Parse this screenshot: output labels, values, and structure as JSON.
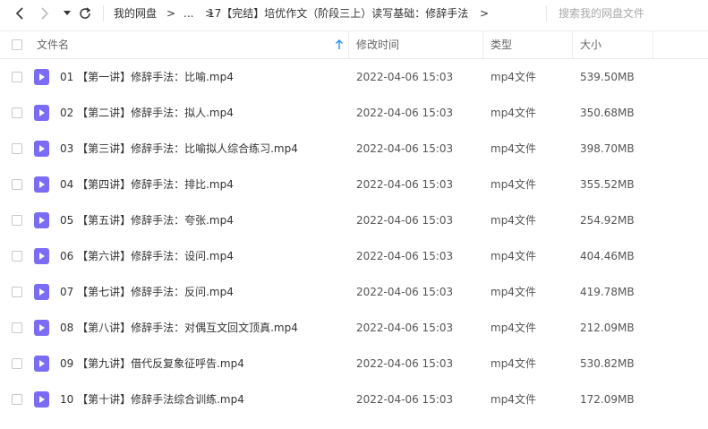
{
  "toolbar": {
    "back_icon": "chevron-left-icon",
    "forward_icon": "chevron-right-icon",
    "dropdown_icon": "caret-down-icon",
    "refresh_icon": "refresh-icon",
    "breadcrumb": {
      "root": "我的网盘",
      "sep1": ">",
      "ellipsis": "...",
      "current": "17【完结】培优作文（阶段三上）读写基础：修辞手法",
      "sep2": ">",
      "sep3": ">"
    },
    "search_placeholder": "搜索我的网盘文件"
  },
  "header": {
    "name": "文件名",
    "modified": "修改时间",
    "type": "类型",
    "size": "大小",
    "sort_icon": "sort-up-arrow-icon",
    "sort_color": "#1e90ff"
  },
  "file_icon_color": "#7b6cf6",
  "files": [
    {
      "name": "01 【第一讲】修辞手法：比喻.mp4",
      "modified": "2022-04-06 15:03",
      "type": "mp4文件",
      "size": "539.50MB"
    },
    {
      "name": "02 【第二讲】修辞手法：拟人.mp4",
      "modified": "2022-04-06 15:03",
      "type": "mp4文件",
      "size": "350.68MB"
    },
    {
      "name": "03 【第三讲】修辞手法：比喻拟人综合练习.mp4",
      "modified": "2022-04-06 15:03",
      "type": "mp4文件",
      "size": "398.70MB"
    },
    {
      "name": "04 【第四讲】修辞手法：排比.mp4",
      "modified": "2022-04-06 15:03",
      "type": "mp4文件",
      "size": "355.52MB"
    },
    {
      "name": "05 【第五讲】修辞手法：夸张.mp4",
      "modified": "2022-04-06 15:03",
      "type": "mp4文件",
      "size": "254.92MB"
    },
    {
      "name": "06 【第六讲】修辞手法：设问.mp4",
      "modified": "2022-04-06 15:03",
      "type": "mp4文件",
      "size": "404.46MB"
    },
    {
      "name": "07 【第七讲】修辞手法：反问.mp4",
      "modified": "2022-04-06 15:03",
      "type": "mp4文件",
      "size": "419.78MB"
    },
    {
      "name": "08 【第八讲】修辞手法：对偶互文回文顶真.mp4",
      "modified": "2022-04-06 15:03",
      "type": "mp4文件",
      "size": "212.09MB"
    },
    {
      "name": "09 【第九讲】借代反复象征呼告.mp4",
      "modified": "2022-04-06 15:03",
      "type": "mp4文件",
      "size": "530.82MB"
    },
    {
      "name": "10 【第十讲】修辞手法综合训练.mp4",
      "modified": "2022-04-06 15:03",
      "type": "mp4文件",
      "size": "172.09MB"
    }
  ]
}
